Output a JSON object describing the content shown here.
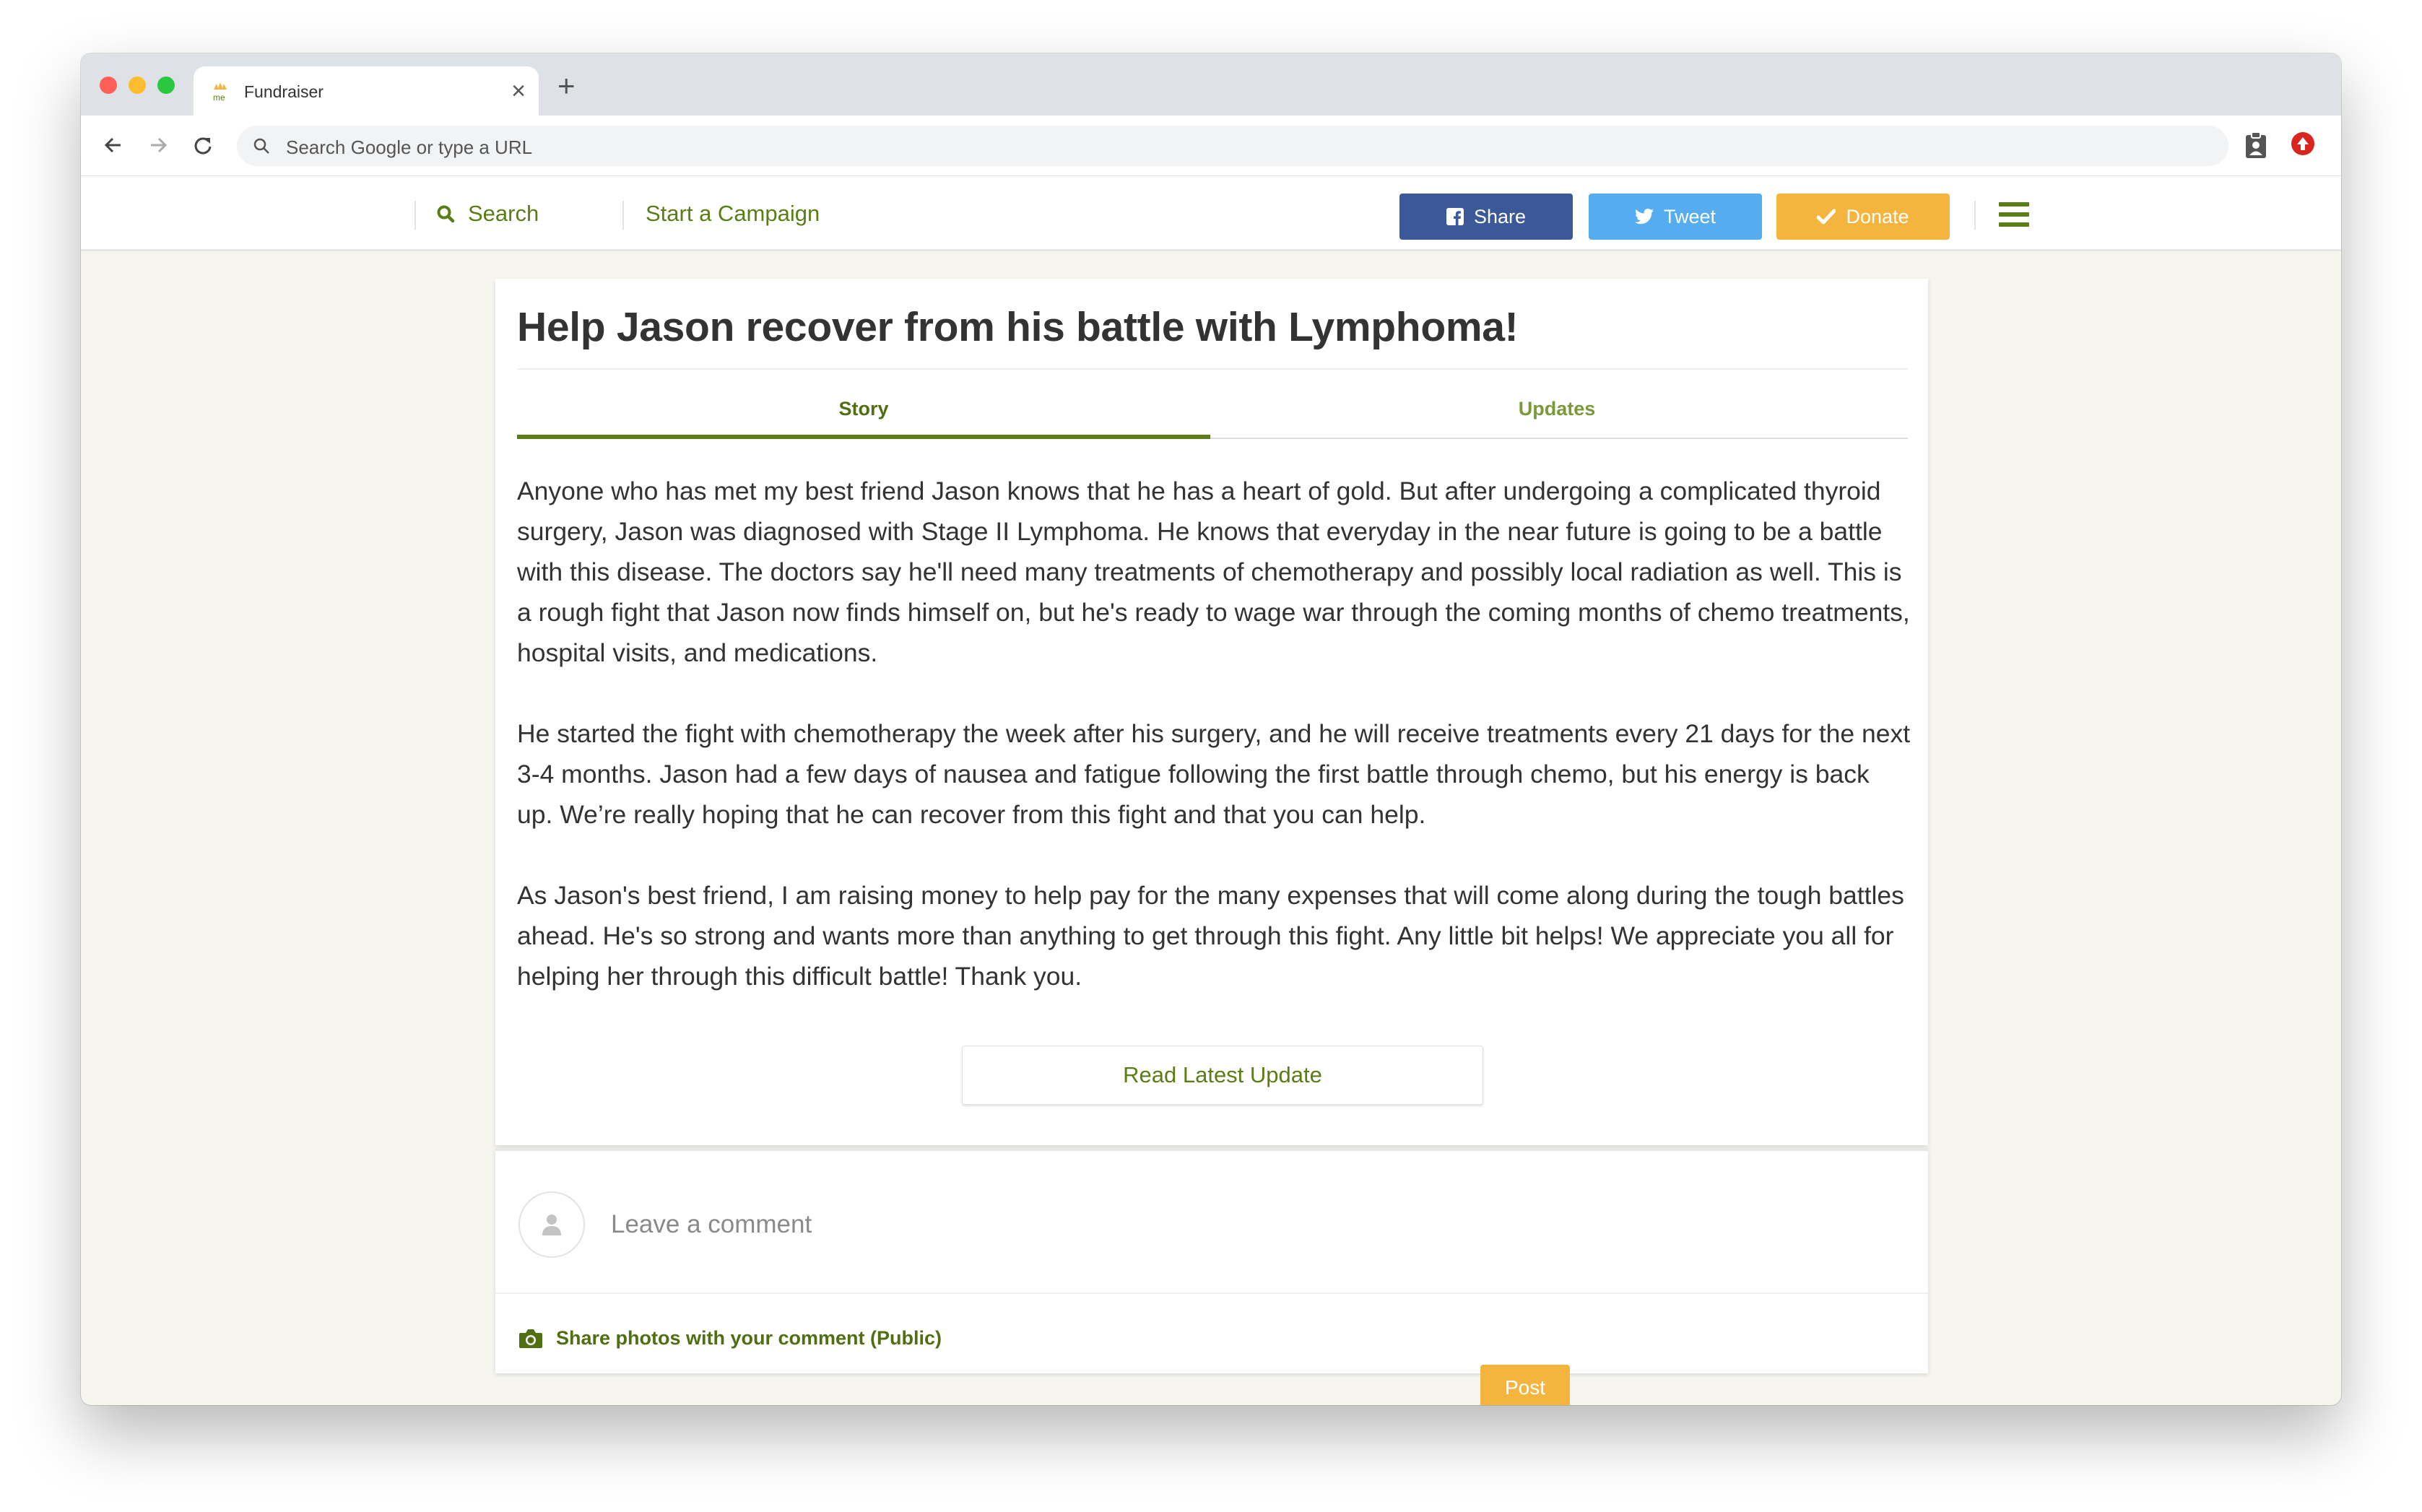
{
  "browser": {
    "tab_title": "Fundraiser",
    "favicon_text": "me",
    "omnibox_placeholder": "Search Google or type a URL"
  },
  "header": {
    "search_label": "Search",
    "start_campaign_label": "Start a Campaign",
    "share_label": "Share",
    "tweet_label": "Tweet",
    "donate_label": "Donate"
  },
  "colors": {
    "brand_green": "#5a7d15",
    "facebook": "#3b5998",
    "twitter": "#55acee",
    "donate": "#f4b53f"
  },
  "campaign": {
    "title": "Help Jason recover from his battle with Lymphoma!",
    "tabs": [
      {
        "label": "Story",
        "active": true
      },
      {
        "label": "Updates",
        "active": false
      }
    ],
    "story": [
      "Anyone who has met my best friend Jason knows that he has a heart of gold. But after undergoing a complicated thyroid surgery, Jason was diagnosed with Stage II Lymphoma. He knows that everyday in the near future is going to be a battle with this disease. The doctors say he'll need many treatments of chemotherapy and possibly local radiation as well. This is a rough fight that Jason now finds himself on, but he's ready to wage war through the coming months of chemo treatments, hospital visits, and medications.",
      "He started the fight with chemotherapy the week after his surgery, and he will receive treatments every 21 days for the next 3-4 months. Jason had a few days of nausea and fatigue following the first battle through chemo, but his energy is back up. We’re really hoping that he can recover from this fight and that you can help.",
      "As Jason's best friend, I am raising money to help pay for the many expenses that will come along during the tough battles ahead. He's so strong and wants more than anything to get through this fight. Any little bit helps! We appreciate you all for helping her through this difficult battle! Thank you."
    ],
    "read_update_label": "Read Latest Update"
  },
  "comment": {
    "placeholder": "Leave a comment",
    "share_photos_label": "Share photos with your comment (Public)",
    "post_label": "Post"
  }
}
